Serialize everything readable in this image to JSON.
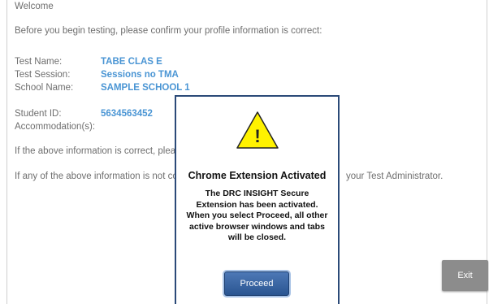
{
  "page": {
    "welcome": "Welcome",
    "intro": "Before you begin testing, please confirm your profile information is correct:"
  },
  "profile": {
    "test_name_label": "Test Name:",
    "test_name": "TABE CLAS E",
    "test_session_label": "Test Session:",
    "test_session": "Sessions no TMA",
    "school_name_label": "School Name:",
    "school_name": "SAMPLE SCHOOL 1",
    "student_id_label": "Student ID:",
    "student_id": "5634563452",
    "accommodation_label": "Accommodation(s):"
  },
  "notes": {
    "correct": "If the above information is correct, plea",
    "incorrect": "If any of the above information is not co",
    "incorrect_tail": "your Test Administrator."
  },
  "buttons": {
    "exit": "Exit"
  },
  "modal": {
    "title": "Chrome Extension Activated",
    "body_line1": "The DRC INSIGHT Secure",
    "body_line2": "Extension has been activated.",
    "body_line3": "When you select Proceed, all other",
    "body_line4": "active browser windows and tabs",
    "body_line5": "will be closed.",
    "icon_glyph": "!",
    "icon": "warning-triangle-icon",
    "proceed": "Proceed"
  },
  "colors": {
    "value_blue": "#4a95d4",
    "modal_border": "#2b4a78",
    "warning_yellow": "#fff200",
    "proceed_button": "#2a5591",
    "exit_button": "#8c8c8c"
  }
}
